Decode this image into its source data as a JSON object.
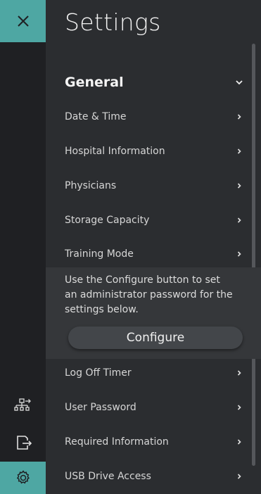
{
  "rail": {
    "close_icon": "close-icon",
    "network_icon": "network-transfer-icon",
    "export_icon": "export-icon",
    "settings_icon": "gear-icon"
  },
  "title": "Settings",
  "general": {
    "label": "General",
    "items": [
      {
        "label": "Date & Time"
      },
      {
        "label": "Hospital Information"
      },
      {
        "label": "Physicians"
      },
      {
        "label": "Storage Capacity"
      },
      {
        "label": "Training Mode"
      }
    ]
  },
  "admin": {
    "info": "Use the Configure button to set an administrator password for the settings below.",
    "configure_label": "Configure",
    "items": [
      {
        "label": "Log Off Timer"
      },
      {
        "label": "User Password"
      },
      {
        "label": "Required Information"
      },
      {
        "label": "USB Drive Access"
      }
    ]
  },
  "colors": {
    "accent": "#4ea7a3",
    "rail_bg": "#1f2023",
    "panel_bg": "#2b2d30"
  }
}
